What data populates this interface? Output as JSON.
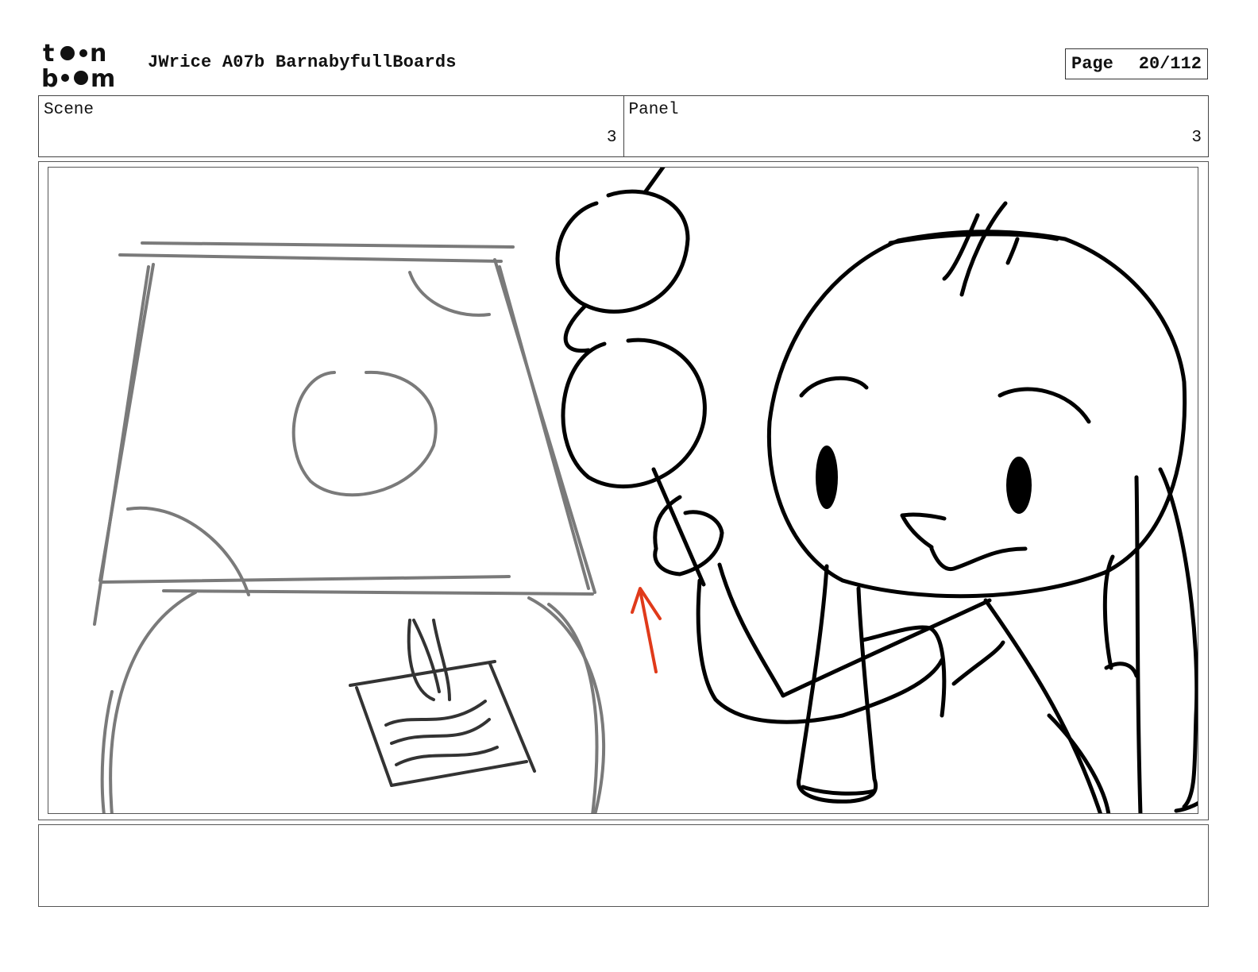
{
  "header": {
    "logo_text": "toon boom",
    "document_title": "JWrice A07b BarnabyfullBoards",
    "page_label": "Page",
    "page_number": "20/112"
  },
  "info": {
    "scene_label": "Scene",
    "scene_value": "3",
    "panel_label": "Panel",
    "panel_value": "3"
  },
  "panel": {
    "drawing": "storyboard-sketch",
    "colors": {
      "ink": "#000000",
      "background_sketch": "#7a7a7a",
      "arrow": "#e03a1a"
    }
  },
  "notes": {
    "action_text": ""
  }
}
